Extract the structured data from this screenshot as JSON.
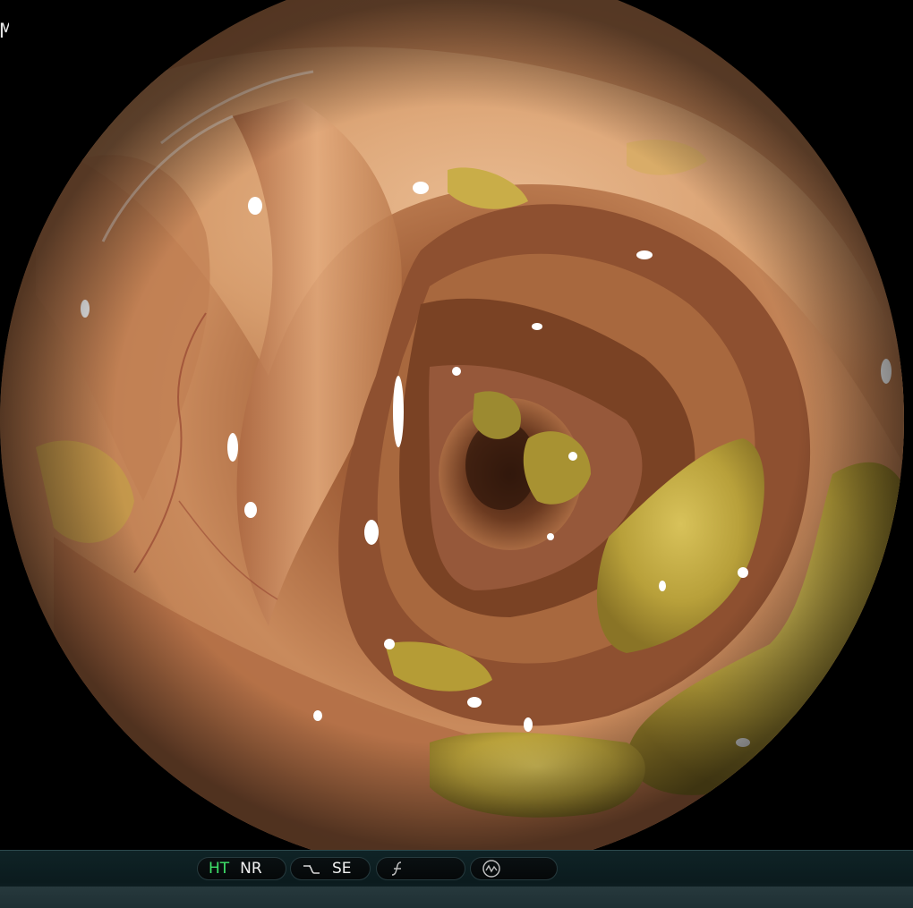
{
  "overlay": {
    "corner_text": "M"
  },
  "image": {
    "subject": "endoscopic-colon-lumen",
    "colors": {
      "mucosa": "#c98a5c",
      "mucosa_highlight": "#e8b98c",
      "lumen_dark": "#3a1d10",
      "residue": "#b8a03a",
      "frame": "#000000"
    }
  },
  "status_bar": {
    "mode_1_label": "HT",
    "mode_2_label": "NR",
    "mode_3_label": "SE",
    "mode_1_active_color": "#3fe36a",
    "icons": [
      "wave-enhance-icon",
      "sharpness-icon",
      "camera-mode-icon"
    ]
  }
}
